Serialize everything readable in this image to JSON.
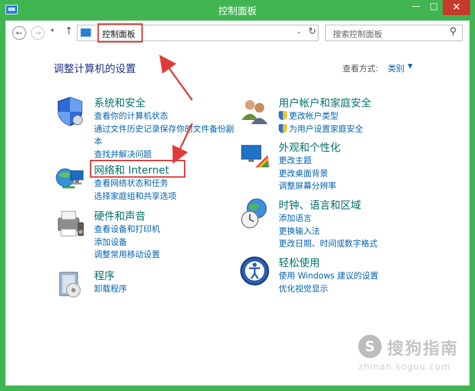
{
  "window": {
    "title": "控制面板",
    "minimize_glyph": "—",
    "maximize_glyph": "□",
    "close_glyph": "✕"
  },
  "toolbar": {
    "back_glyph": "←",
    "forward_glyph": "→",
    "recent_glyph": "▾",
    "up_glyph": "↑",
    "address": "控制面板",
    "address_dropdown_glyph": "⌄",
    "refresh_glyph": "↻",
    "search_placeholder": "搜索控制面板",
    "search_glyph": "⚲"
  },
  "header": {
    "title": "调整计算机的设置",
    "view_label": "查看方式:",
    "view_value": "类别",
    "view_arrow": "▼"
  },
  "categories": [
    {
      "title": "系统和安全",
      "icon": "shield-icon",
      "links": [
        "查看你的计算机状态",
        "通过文件历史记录保存你的文件备份副本",
        "查找并解决问题"
      ]
    },
    {
      "title": "网络和 Internet",
      "icon": "network-icon",
      "links": [
        "查看网络状态和任务",
        "选择家庭组和共享选项"
      ]
    },
    {
      "title": "硬件和声音",
      "icon": "printer-icon",
      "links": [
        "查看设备和打印机",
        "添加设备",
        "调整常用移动设置"
      ]
    },
    {
      "title": "程序",
      "icon": "programs-icon",
      "links": [
        "卸载程序"
      ]
    },
    {
      "title": "用户帐户和家庭安全",
      "icon": "users-icon",
      "links": [
        "更改帐户类型",
        "为用户设置家庭安全"
      ]
    },
    {
      "title": "外观和个性化",
      "icon": "appearance-icon",
      "links": [
        "更改主题",
        "更改桌面背景",
        "调整屏幕分辨率"
      ]
    },
    {
      "title": "时钟、语言和区域",
      "icon": "clock-globe-icon",
      "links": [
        "添加语言",
        "更换输入法",
        "更改日期、时间或数字格式"
      ]
    },
    {
      "title": "轻松使用",
      "icon": "ease-of-access-icon",
      "links": [
        "使用 Windows 建议的设置",
        "优化视觉显示"
      ]
    }
  ],
  "watermark": {
    "mark": "S",
    "text": "搜狗指南",
    "url": "zhinan.sogou.com"
  },
  "colors": {
    "titlebar": "#41b552",
    "heading": "#1e3287",
    "category_title": "#00706a",
    "link": "#0063b1",
    "annotation": "#e03b3b"
  }
}
